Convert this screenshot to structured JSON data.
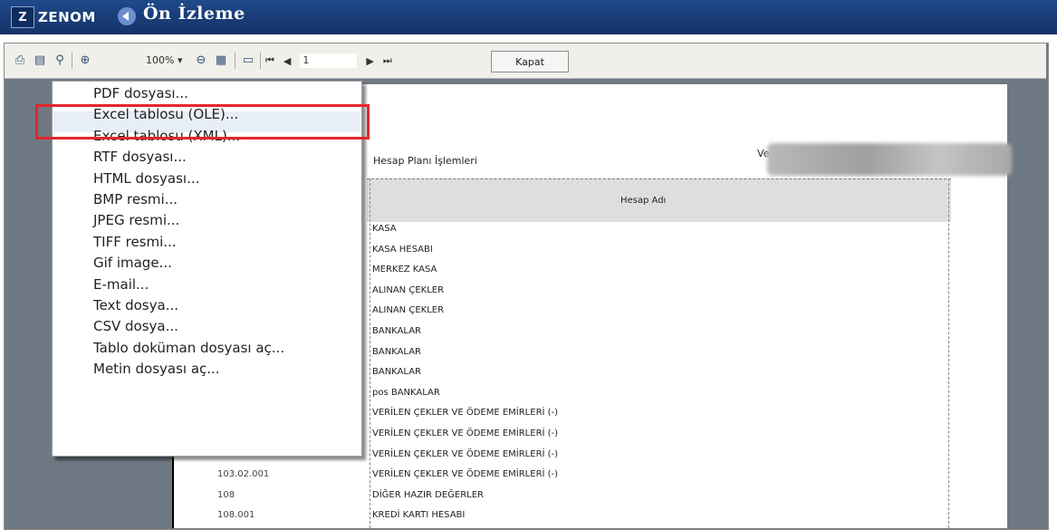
{
  "window": {
    "logo_glyph": "Z",
    "app_name": "ZENOM",
    "title": "Ön İzleme"
  },
  "toolbar": {
    "zoom_value": "100%",
    "page_value": "1",
    "close_label": "Kapat",
    "icons": [
      "print-icon",
      "export-icon",
      "find-icon",
      "zoom-in-icon",
      "zoom-dropdown-icon",
      "zoom-out-icon",
      "page-view-icon",
      "single-page-icon",
      "first-page-icon",
      "prev-page-icon",
      "next-page-icon",
      "last-page-icon"
    ]
  },
  "report": {
    "title": "Hesap Planı İşlemleri",
    "ve_label": "Ve",
    "column_header": "Hesap Adı",
    "rows": [
      {
        "code": "",
        "name": "KASA"
      },
      {
        "code": "",
        "name": "KASA HESABI"
      },
      {
        "code": "",
        "name": "MERKEZ KASA"
      },
      {
        "code": "",
        "name": "ALINAN ÇEKLER"
      },
      {
        "code": "",
        "name": "ALINAN ÇEKLER"
      },
      {
        "code": "",
        "name": "BANKALAR"
      },
      {
        "code": "",
        "name": "BANKALAR"
      },
      {
        "code": "",
        "name": "BANKALAR"
      },
      {
        "code": "",
        "name": "pos BANKALAR"
      },
      {
        "code": "",
        "name": "VERİLEN ÇEKLER VE ÖDEME EMİRLERİ (-)"
      },
      {
        "code": "",
        "name": "VERİLEN ÇEKLER VE ÖDEME EMİRLERİ (-)"
      },
      {
        "code": "",
        "name": "VERİLEN ÇEKLER VE ÖDEME EMİRLERİ (-)"
      },
      {
        "code": "103.02.001",
        "name": "VERİLEN ÇEKLER VE ÖDEME EMİRLERİ (-)"
      },
      {
        "code": "108",
        "name": "DİĞER HAZIR DEĞERLER"
      },
      {
        "code": "108.001",
        "name": "KREDİ KARTI HESABI"
      }
    ]
  },
  "export_menu": {
    "items": [
      "PDF dosyası...",
      "Excel tablosu (OLE)...",
      "Excel tablosu (XML)...",
      "RTF dosyası...",
      "HTML dosyası...",
      "BMP resmi...",
      "JPEG resmi...",
      "TIFF resmi...",
      "Gif image...",
      "E-mail...",
      "Text dosya...",
      "CSV dosya...",
      "Tablo doküman dosyası aç...",
      "Metin dosyası aç..."
    ],
    "highlighted_item": "Excel tablosu (OLE)...",
    "highlight_color": "#e3262b"
  }
}
